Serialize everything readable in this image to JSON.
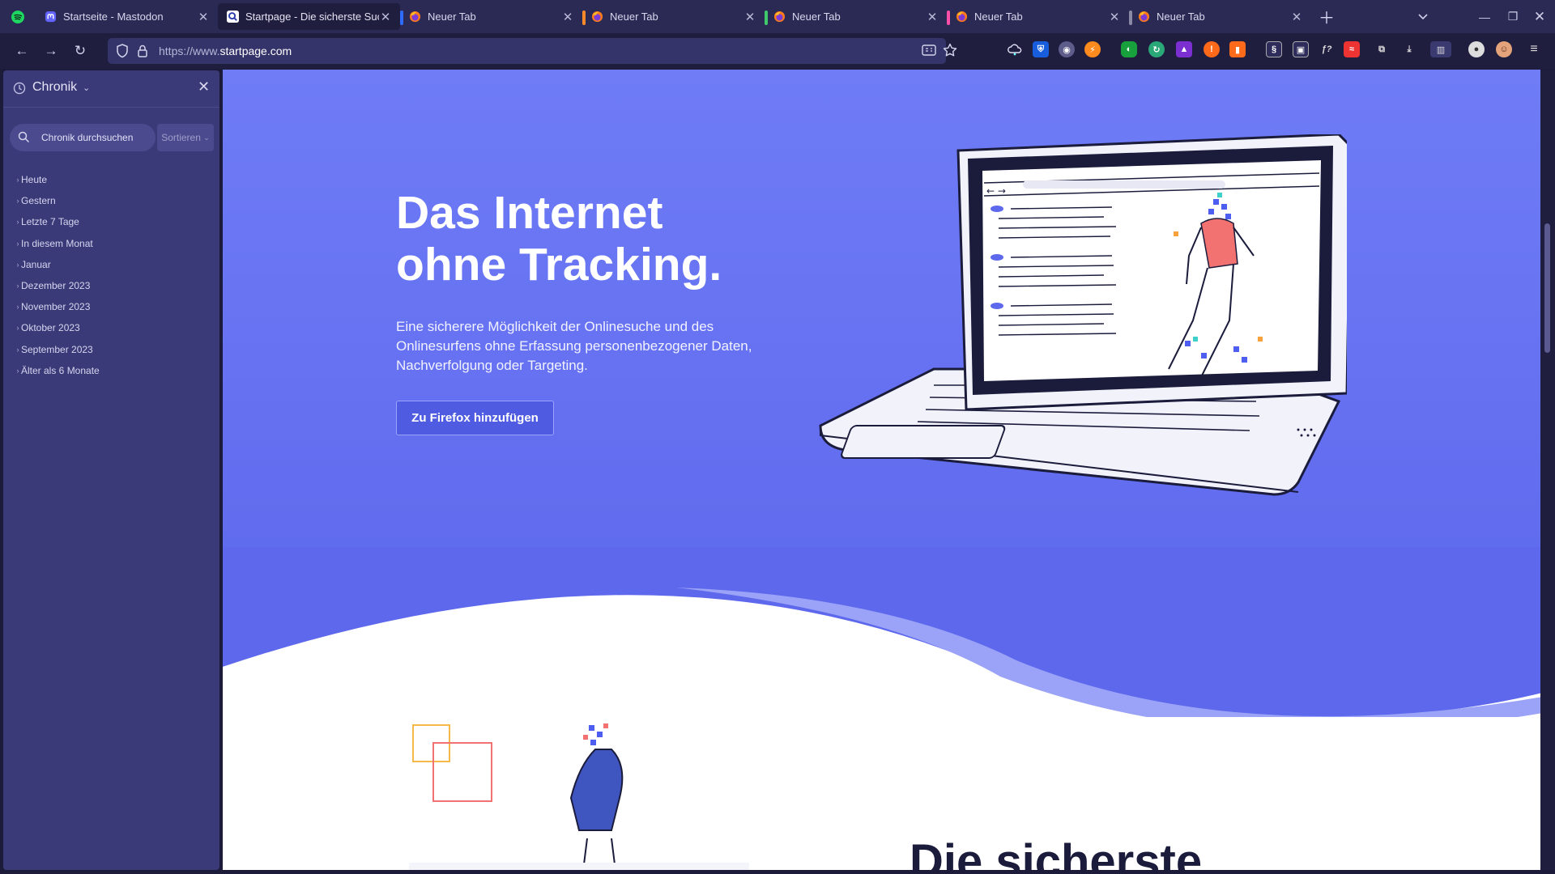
{
  "tabs": [
    {
      "title": "Startseite - Mastodon",
      "icon": "mastodon-icon",
      "accent": "",
      "active": false
    },
    {
      "title": "Startpage - Die sicherste Suchmaschine",
      "icon": "startpage-icon",
      "accent": "",
      "active": true
    },
    {
      "title": "Neuer Tab",
      "icon": "firefox-icon",
      "accent": "#2f6bff",
      "active": false
    },
    {
      "title": "Neuer Tab",
      "icon": "firefox-icon",
      "accent": "#ff8a2a",
      "active": false
    },
    {
      "title": "Neuer Tab",
      "icon": "firefox-icon",
      "accent": "#3fc96a",
      "active": false
    },
    {
      "title": "Neuer Tab",
      "icon": "firefox-icon",
      "accent": "#ff4fa8",
      "active": false
    },
    {
      "title": "Neuer Tab",
      "icon": "firefox-icon",
      "accent": "#8a8aa6",
      "active": false
    }
  ],
  "address_bar": {
    "url_prefix": "https://www.",
    "url_host": "startpage.com"
  },
  "sidebar": {
    "title": "Chronik",
    "search_placeholder": "Chronik durchsuchen",
    "sort_label": "Sortieren",
    "items": [
      {
        "label": "Heute"
      },
      {
        "label": "Gestern"
      },
      {
        "label": "Letzte 7 Tage"
      },
      {
        "label": "In diesem Monat"
      },
      {
        "label": "Januar"
      },
      {
        "label": "Dezember 2023"
      },
      {
        "label": "November 2023"
      },
      {
        "label": "Oktober 2023"
      },
      {
        "label": "September 2023"
      },
      {
        "label": "Älter als 6 Monate"
      }
    ]
  },
  "hero": {
    "headline_line1": "Das Internet",
    "headline_line2": "ohne Tracking.",
    "subtitle": "Eine sicherere Möglichkeit der Onlinesuche und des Onlinesurfens ohne Erfassung personenbezogener Daten, Nachverfolgung oder Targeting.",
    "cta_label": "Zu Firefox hinzufügen"
  },
  "section2": {
    "heading": "Die sicherste"
  },
  "colors": {
    "hero_bg": "#6270f0",
    "sidebar_bg": "#3b3a78",
    "toolbar_bg": "#1f1e3e",
    "tabstrip_bg": "#2b2a54"
  }
}
